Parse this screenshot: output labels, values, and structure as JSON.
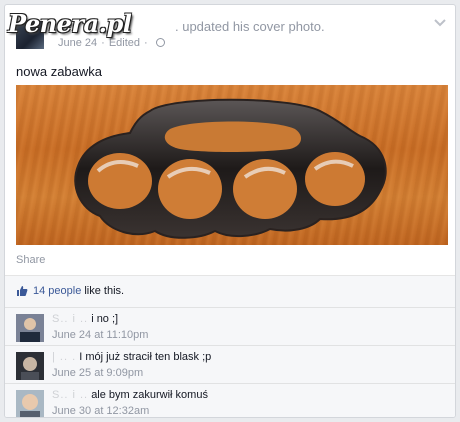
{
  "watermark": "Penera.pl",
  "post": {
    "action": ". updated his cover photo.",
    "date": "June 24",
    "edited": "Edited",
    "text": "nowa zabawka"
  },
  "share_label": "Share",
  "likes": {
    "count": "14 people",
    "suffix": "like this."
  },
  "comments": [
    {
      "name": "S..  i   ..",
      "text": "i no ;]",
      "time": "June 24 at 11:10pm"
    },
    {
      "name": "|     ..  .",
      "text": "I mój już stracił ten blask ;p",
      "time": "June 25 at 9:09pm"
    },
    {
      "name": "S..  i   ..",
      "text": "ale bym zakurwił komuś",
      "time": "June 30 at 12:32am"
    }
  ],
  "colors": {
    "link": "#3b5998",
    "meta": "#9197a3",
    "background": "#e9ebee"
  },
  "icons": [
    "globe-icon",
    "chevron-down-icon",
    "like-icon"
  ]
}
